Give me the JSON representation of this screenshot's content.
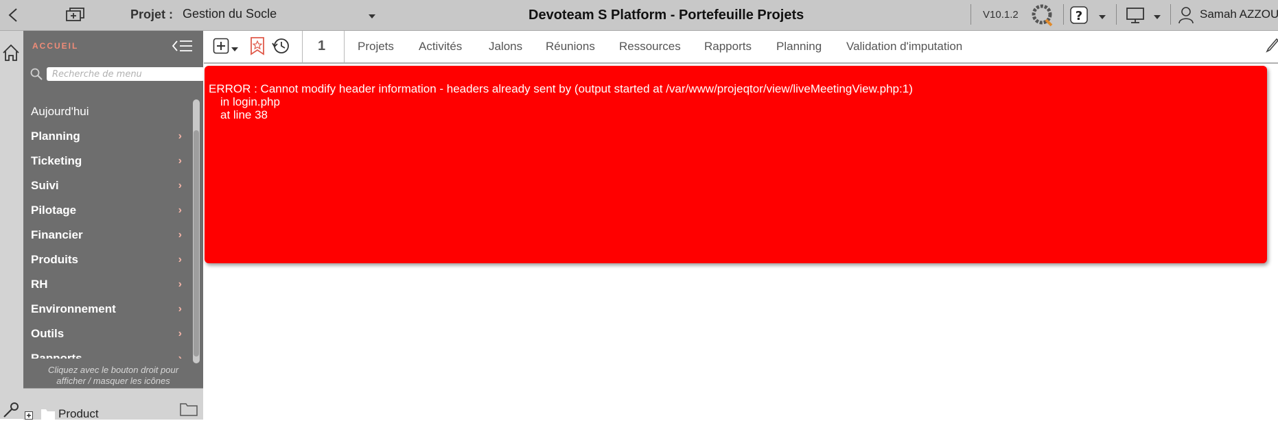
{
  "header": {
    "project_label": "Projet :",
    "project_value": "Gestion du Socle",
    "app_title": "Devoteam S Platform - Portefeuille Projets",
    "version": "V10.1.2",
    "user_name": "Samah AZZOU"
  },
  "sidebar": {
    "section_title": "ACCUEIL",
    "search_placeholder": "Recherche de menu",
    "items": [
      {
        "label": "Aujourd'hui"
      },
      {
        "label": "Planning"
      },
      {
        "label": "Ticketing"
      },
      {
        "label": "Suivi"
      },
      {
        "label": "Pilotage"
      },
      {
        "label": "Financier"
      },
      {
        "label": "Produits"
      },
      {
        "label": "RH"
      },
      {
        "label": "Environnement"
      },
      {
        "label": "Outils"
      },
      {
        "label": "Rapports"
      }
    ],
    "chevron": "›",
    "hint_line1": "Cliquez avec le bouton droit pour",
    "hint_line2": "afficher / masquer les icônes",
    "tree_item": "Product"
  },
  "toolbar": {
    "counter": "1",
    "nav": [
      "Projets",
      "Activités",
      "Jalons",
      "Réunions",
      "Ressources",
      "Rapports",
      "Planning",
      "Validation d'imputation"
    ]
  },
  "error": {
    "line1": "ERROR : Cannot modify header information - headers already sent by (output started at /var/www/projeqtor/view/liveMeetingView.php:1)",
    "line2": "in login.php",
    "line3": "at line 38"
  },
  "colors": {
    "error_bg": "#ff0000",
    "sidebar_bg": "#6e6e6e",
    "accent": "#f08c78",
    "topbar_bg": "#c8c8c8"
  }
}
